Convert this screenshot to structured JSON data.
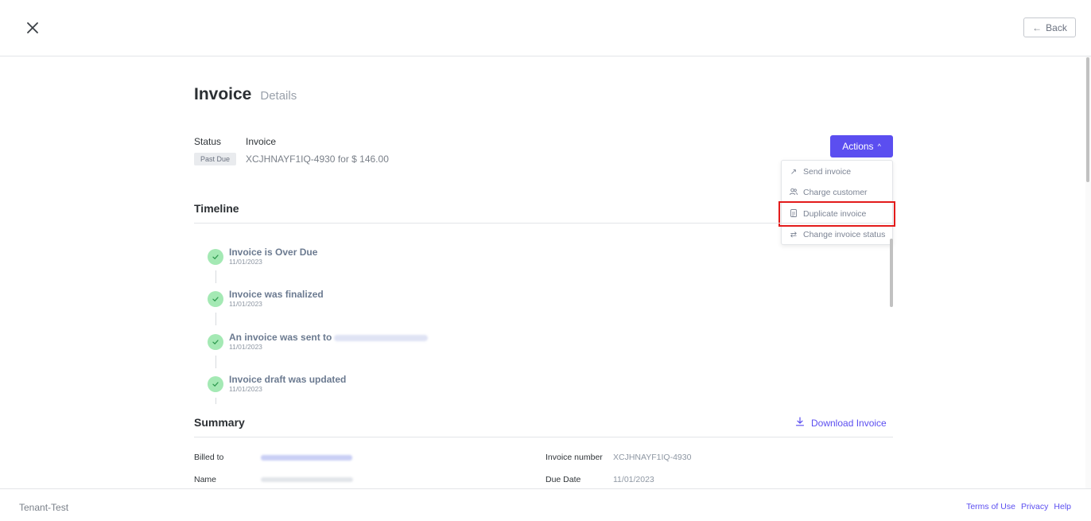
{
  "header": {
    "back_label": "Back"
  },
  "page": {
    "title": "Invoice",
    "subtitle": "Details"
  },
  "status": {
    "status_label": "Status",
    "invoice_label": "Invoice",
    "badge": "Past Due",
    "invoice_text": "XCJHNAYF1IQ-4930 for $ 146.00"
  },
  "actions": {
    "button_label": "Actions",
    "items": [
      {
        "label": "Send invoice",
        "icon": "arrow-up-right-icon"
      },
      {
        "label": "Charge customer",
        "icon": "users-icon"
      },
      {
        "label": "Duplicate invoice",
        "icon": "document-icon"
      },
      {
        "label": "Change invoice status",
        "icon": "swap-arrows-icon"
      }
    ]
  },
  "timeline": {
    "title": "Timeline",
    "events": [
      {
        "title": "Invoice is Over Due",
        "date": "11/01/2023"
      },
      {
        "title": "Invoice was finalized",
        "date": "11/01/2023"
      },
      {
        "title": "An invoice was sent to",
        "date": "11/01/2023"
      },
      {
        "title": "Invoice draft was updated",
        "date": "11/01/2023"
      }
    ]
  },
  "summary": {
    "title": "Summary",
    "download_label": "Download Invoice",
    "billed_to_label": "Billed to",
    "name_label": "Name",
    "invoice_number_label": "Invoice number",
    "invoice_number": "XCJHNAYF1IQ-4930",
    "due_date_label": "Due Date",
    "due_date": "11/01/2023"
  },
  "footer": {
    "tenant": "Tenant-Test",
    "links": [
      "Terms of Use",
      "Privacy",
      "Help"
    ]
  },
  "colors": {
    "accent": "#5b4ef0",
    "success": "#a4e9b4",
    "highlight": "#e31b1b"
  }
}
